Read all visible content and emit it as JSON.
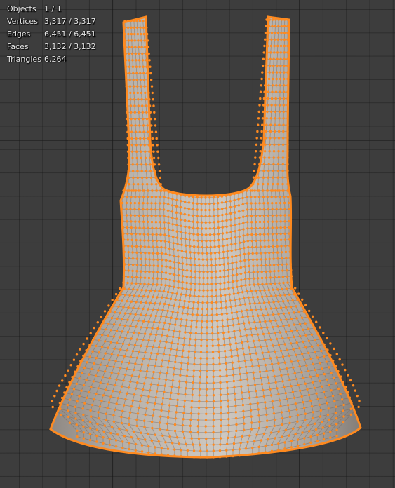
{
  "viewport": {
    "background_color": "#3d3d3d",
    "grid_color": "#2b2b2b",
    "axis_color": "#5a7fb8",
    "selection_color": "#ff8a1f",
    "mesh_color": "#bdb6ae"
  },
  "stats": [
    {
      "label": "Objects",
      "value": "1 / 1"
    },
    {
      "label": "Vertices",
      "value": "3,317 / 3,317"
    },
    {
      "label": "Edges",
      "value": "6,451 / 6,451"
    },
    {
      "label": "Faces",
      "value": "3,132 / 3,132"
    },
    {
      "label": "Triangles",
      "value": "6,264"
    }
  ]
}
